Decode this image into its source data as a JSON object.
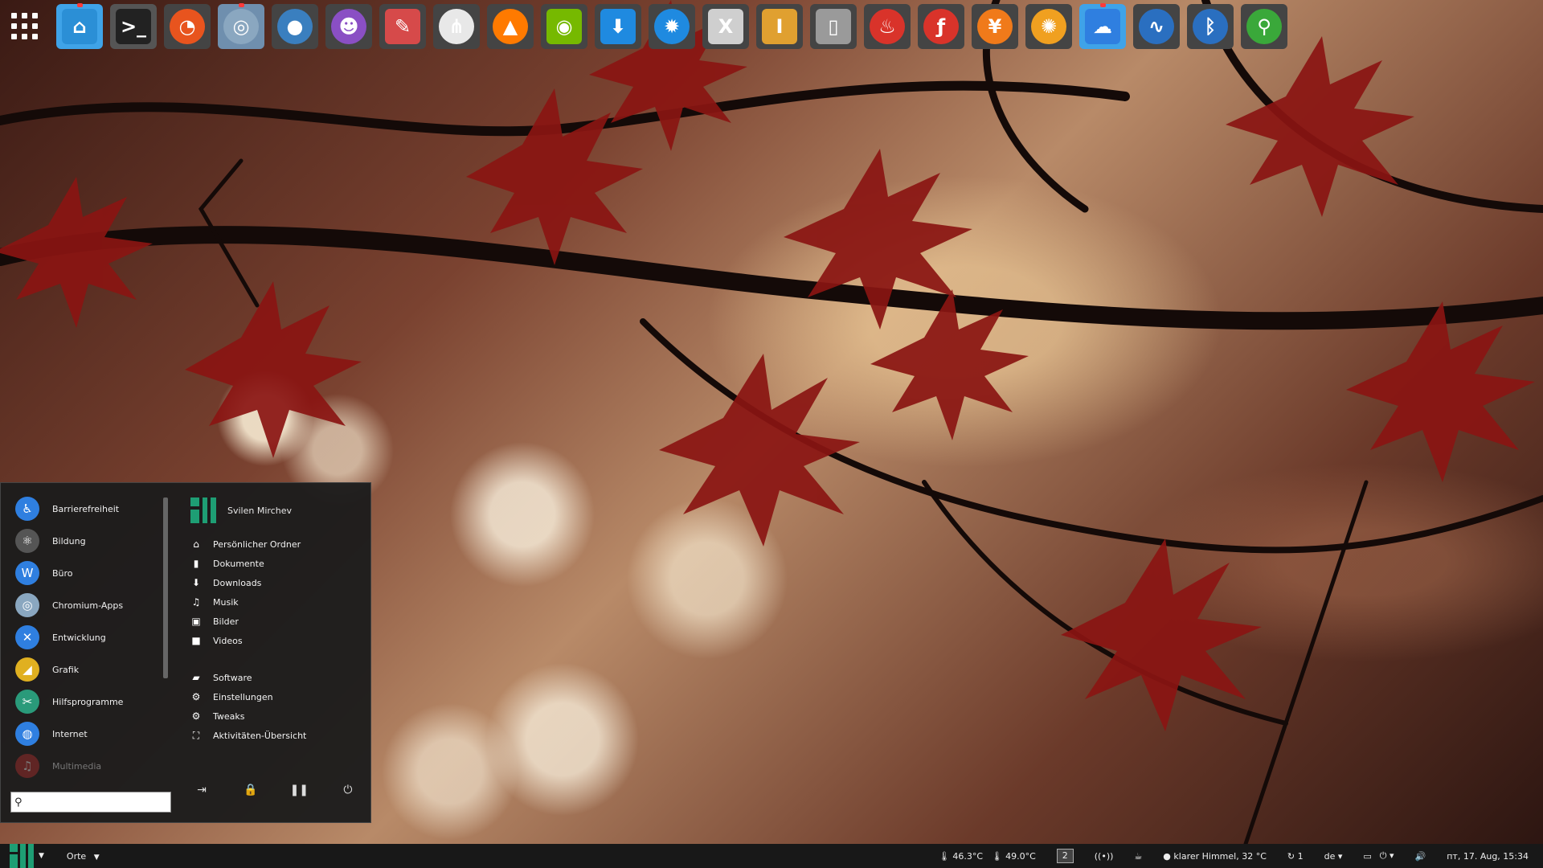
{
  "dock": {
    "apps": [
      {
        "name": "files",
        "glyph": "⌂",
        "bg": "#2b8fd6",
        "ring": "#3fa3e8",
        "active": true,
        "sq": true
      },
      {
        "name": "terminal",
        "glyph": ">_",
        "bg": "#222",
        "ring": "#555",
        "sq": true
      },
      {
        "name": "firefox",
        "glyph": "◔",
        "bg": "#e8541e",
        "ring": "#444"
      },
      {
        "name": "chromium",
        "glyph": "◎",
        "bg": "#8aa7c0",
        "ring": "#6f8fae",
        "active": true
      },
      {
        "name": "earth",
        "glyph": "●",
        "bg": "#3a7fbf",
        "ring": "#444"
      },
      {
        "name": "bird",
        "glyph": "☻",
        "bg": "#8a4fc4",
        "ring": "#444"
      },
      {
        "name": "editor",
        "glyph": "✎",
        "bg": "#d64a4a",
        "ring": "#444",
        "sq": true
      },
      {
        "name": "antenna",
        "glyph": "⋔",
        "bg": "#e8e8e8",
        "ring": "#444"
      },
      {
        "name": "vlc",
        "glyph": "▲",
        "bg": "#ff7a00",
        "ring": "#444"
      },
      {
        "name": "nvidia",
        "glyph": "◉",
        "bg": "#76b900",
        "ring": "#444",
        "sq": true
      },
      {
        "name": "download",
        "glyph": "⬇",
        "bg": "#1f8ae0",
        "ring": "#444",
        "sq": true
      },
      {
        "name": "settings",
        "glyph": "✹",
        "bg": "#1f8ae0",
        "ring": "#444"
      },
      {
        "name": "mplab-xide",
        "glyph": "X",
        "bg": "#cfcfcf",
        "ring": "#444",
        "sq": true
      },
      {
        "name": "mplab-ipe",
        "glyph": "I",
        "bg": "#e0a030",
        "ring": "#444",
        "sq": true
      },
      {
        "name": "document",
        "glyph": "▯",
        "bg": "#9a9a9a",
        "ring": "#444",
        "sq": true
      },
      {
        "name": "java",
        "glyph": "♨",
        "bg": "#d9332a",
        "ring": "#444"
      },
      {
        "name": "flash",
        "glyph": "ƒ",
        "bg": "#d9332a",
        "ring": "#444"
      },
      {
        "name": "cutlery",
        "glyph": "¥",
        "bg": "#f07a1a",
        "ring": "#444"
      },
      {
        "name": "xsane",
        "glyph": "✺",
        "bg": "#f0a020",
        "ring": "#444"
      },
      {
        "name": "weather",
        "glyph": "☁",
        "bg": "#2f7fe0",
        "ring": "#3fa3e8",
        "active": true,
        "sq": true
      },
      {
        "name": "waveform",
        "glyph": "∿",
        "bg": "#2a6fc0",
        "ring": "#444"
      },
      {
        "name": "bluetooth",
        "glyph": "ᛒ",
        "bg": "#2a6fc0",
        "ring": "#444"
      },
      {
        "name": "search",
        "glyph": "⚲",
        "bg": "#3aa83a",
        "ring": "#444"
      }
    ]
  },
  "menu": {
    "categories": [
      {
        "label": "Barrierefreiheit",
        "glyph": "♿",
        "color": "#2f7fe0"
      },
      {
        "label": "Bildung",
        "glyph": "⚛",
        "color": "#555"
      },
      {
        "label": "Büro",
        "glyph": "W",
        "color": "#2f7fe0"
      },
      {
        "label": "Chromium-Apps",
        "glyph": "◎",
        "color": "#8aa7c0"
      },
      {
        "label": "Entwicklung",
        "glyph": "✕",
        "color": "#2f7fe0"
      },
      {
        "label": "Grafik",
        "glyph": "◢",
        "color": "#e0b020"
      },
      {
        "label": "Hilfsprogramme",
        "glyph": "✂",
        "color": "#2a9a7a"
      },
      {
        "label": "Internet",
        "glyph": "◍",
        "color": "#2f7fe0"
      },
      {
        "label": "Multimedia",
        "glyph": "♫",
        "color": "#c03030"
      }
    ],
    "user": "Svilen Mirchev",
    "places": [
      {
        "label": "Persönlicher Ordner",
        "glyph": "⌂"
      },
      {
        "label": "Dokumente",
        "glyph": "▮"
      },
      {
        "label": "Downloads",
        "glyph": "⬇"
      },
      {
        "label": "Musik",
        "glyph": "♫"
      },
      {
        "label": "Bilder",
        "glyph": "▣"
      },
      {
        "label": "Videos",
        "glyph": "■"
      }
    ],
    "system": [
      {
        "label": "Software",
        "glyph": "▰"
      },
      {
        "label": "Einstellungen",
        "glyph": "⚙"
      },
      {
        "label": "Tweaks",
        "glyph": "⚙"
      },
      {
        "label": "Aktivitäten-Übersicht",
        "glyph": "⛶"
      }
    ],
    "search_value": "",
    "actions": [
      "⇥",
      "🔒",
      "❚❚",
      "⏻"
    ]
  },
  "panel": {
    "places_label": "Orte",
    "temp1": "46.3°C",
    "temp2": "49.0°C",
    "workspace": "2",
    "weather": "klarer Himmel, 32 °C",
    "updates": "1",
    "keyboard": "de",
    "clock": "пт, 17. Aug, 15:34"
  },
  "colors": {
    "accent": "#1e9e74",
    "panel": "#181818",
    "menu_bg": "#1c1c1c"
  }
}
